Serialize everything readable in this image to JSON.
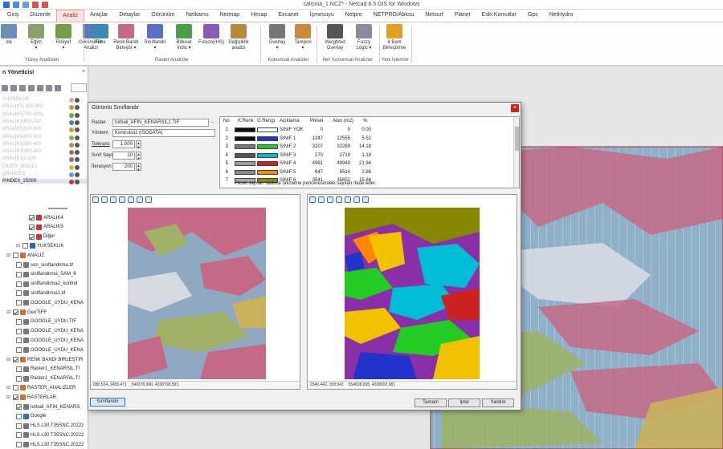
{
  "app": {
    "title": "calisma_1.NCZ* - Netcad 8.5 GIS for Windows"
  },
  "menu": {
    "tabs": [
      "Giriş",
      "Düzenle",
      "Analiz",
      "Araçlar",
      "Detaylar",
      "Görünüm",
      "Netkamu",
      "Netmap",
      "Hesap",
      "Excanet",
      "İçmesuyu",
      "Netpro",
      "NETPRO/Abksu",
      "Netsurf",
      "Planet",
      "Eski Komutlar",
      "Gps",
      "NetHydro"
    ],
    "active": "Analiz"
  },
  "ribbon": {
    "buttons": [
      {
        "label": "ılık",
        "sub": ""
      },
      {
        "label": "Eğim",
        "sub": "▾"
      },
      {
        "label": "Röliyef",
        "sub": "▾"
      },
      {
        "label": "Görünürlük",
        "sub": "Analizi"
      },
      {
        "label": "Filtre",
        "sub": ""
      },
      {
        "label": "Renk Bandı",
        "sub": "Birleştir ▾"
      },
      {
        "label": "Sınıflandır",
        "sub": "▾"
      },
      {
        "label": "Bitkisel",
        "sub": "İndis ▾"
      },
      {
        "label": "Fusion(IHS)",
        "sub": ""
      },
      {
        "label": "Değişiklik",
        "sub": "analizi"
      },
      {
        "label": "Overlay",
        "sub": "▾"
      },
      {
        "label": "Tampon",
        "sub": "▾"
      },
      {
        "label": "Weighted",
        "sub": "Overlay"
      },
      {
        "label": "Fuzzy",
        "sub": "Logic ▾"
      },
      {
        "label": "4 Bant",
        "sub": "Birleştirme"
      }
    ],
    "groups": [
      "Yüzey Analizleri",
      "Raster Analizler",
      "Konumsal Analizler",
      "İleri Konumsal Analizler",
      "Yeni İşlemler"
    ]
  },
  "panel": {
    "title": "n Yöneticisi",
    "close": "×",
    "layers": [
      {
        "name": "YUKSEKLIK",
        "dim": true
      },
      {
        "name": "ARALIK5(-800-900",
        "dim": true
      },
      {
        "name": "ARALIK5(700-800)",
        "dim": true
      },
      {
        "name": "ARALIK7(600-700",
        "dim": true
      },
      {
        "name": "ARALIK5(500-600",
        "dim": true
      },
      {
        "name": "ARALIK5(400-500",
        "dim": true
      },
      {
        "name": "ARALIK3(300-400",
        "dim": true
      },
      {
        "name": "ARALIK2(200-300",
        "dim": true
      },
      {
        "name": "ARALIK1(0-100",
        "dim": true
      },
      {
        "name": "DIGER_MODEL",
        "dim": true
      },
      {
        "name": "@PINDEX",
        "dim": true
      },
      {
        "name": "PINDEX_25000",
        "dim": false
      }
    ],
    "tree": [
      "ARALIK4",
      "ARALIK5",
      "Diğer",
      "YUKSEKLIK",
      "ANALIZ",
      "son_siniflandirma.tif",
      "siniflandirma_SAM_8",
      "siniflandirma2_kontrol",
      "siniflandirma1.tif",
      "GOOGLE_UYDU_KENA",
      "GeoTIFF",
      "GOOGLE_UYDU.TIF",
      "GOOGLE_UYDU_KENA",
      "GOOGLE_UYDU_KENA",
      "GOOGLE_UYDU_KENA",
      "RENK BANDI BIRLEŞTIR",
      "Raster1_KENARSIL.TI",
      "Raster1_KENARSIL.TI",
      "RASTER_ANALIZLER",
      "RASTERLAR",
      "torbali_AFIN_KENARS",
      "Google",
      "HLS.L30.T35SNC.20222",
      "HLS.L30.T35SNC.20222",
      "HLS.L30.T35SNC.20222"
    ]
  },
  "dialog": {
    "title": "Görüntü Sınıflandır",
    "close": "×",
    "raster_label": "Raster",
    "raster_value": "torbali_AFIN_KENARSIL1.TIF",
    "method_label": "Yöntem",
    "method_value": "Kontrolsüz (ISODATA)",
    "tolerance_label": "Tolerans",
    "tolerance_value": "1.000",
    "class_count_label": "Sınıf Sayısı",
    "class_count_value": "10",
    "iteration_label": "İterasyon",
    "iteration_value": "200",
    "table_headers": [
      "No",
      "K.Renk",
      "G.Rengi",
      "Açıklama",
      "Piksel",
      "Alan (m2)",
      "%"
    ],
    "rows": [
      {
        "no": "1",
        "k": "#111111",
        "g": "#ffffff",
        "desc": "SINIF YOK",
        "px": "0",
        "area": "0",
        "pct": "0.00"
      },
      {
        "no": "2",
        "k": "#111111",
        "g": "#2233cc",
        "desc": "SINIF 1",
        "px": "1247",
        "area": "12555",
        "pct": "5.52"
      },
      {
        "no": "3",
        "k": "#777777",
        "g": "#22cc22",
        "desc": "SINIF 2",
        "px": "3207",
        "area": "32289",
        "pct": "14.18"
      },
      {
        "no": "4",
        "k": "#555555",
        "g": "#00bcd4",
        "desc": "SINIF 3",
        "px": "270",
        "area": "2719",
        "pct": "1.19"
      },
      {
        "no": "5",
        "k": "#999999",
        "g": "#cc2222",
        "desc": "SINIF 4",
        "px": "4961",
        "area": "49949",
        "pct": "21.94"
      },
      {
        "no": "6",
        "k": "#888888",
        "g": "#ff8800",
        "desc": "SINIF 5",
        "px": "647",
        "area": "6514",
        "pct": "2.86"
      },
      {
        "no": "7",
        "k": "#aaaaaa",
        "g": "#888800",
        "desc": "SINIF 6",
        "px": "3541",
        "area": "35652",
        "pct": "15.66"
      }
    ],
    "note": "Piksel sayıları sadece önizleme penceresindeki sayıları ifade eder.",
    "left_status": [
      "080.524, 2455.471",
      "549376.960, 4230790.593"
    ],
    "right_status": [
      "2340.442, 158.541",
      "554838.035, 4228092.981"
    ],
    "btn_classify": "Sınıflandır",
    "btn_ok": "Tamam",
    "btn_cancel": "İptal",
    "btn_help": "Yardım"
  }
}
